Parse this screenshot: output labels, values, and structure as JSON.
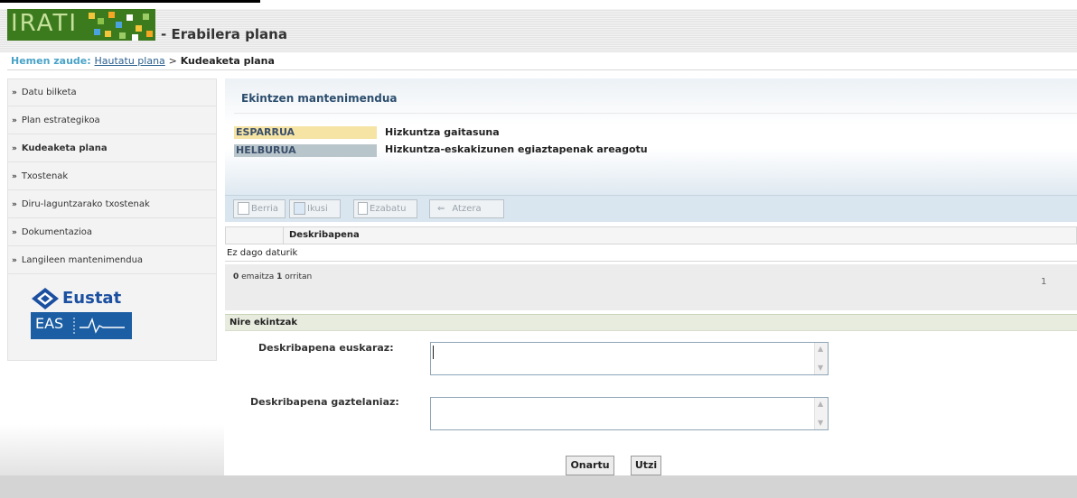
{
  "header": {
    "logo_text": "IRATI",
    "app_title": "- Erabilera plana"
  },
  "breadcrumb": {
    "label": "Hemen zaude:",
    "link": "Hautatu plana",
    "separator": ">",
    "current": "Kudeaketa plana"
  },
  "sidebar": {
    "chevron": "»",
    "items": [
      {
        "label": "Datu bilketa"
      },
      {
        "label": "Plan estrategikoa"
      },
      {
        "label": "Kudeaketa plana",
        "active": true
      },
      {
        "label": "Txostenak"
      },
      {
        "label": "Diru-laguntzarako txostenak"
      },
      {
        "label": "Dokumentazioa"
      },
      {
        "label": "Langileen mantenimendua"
      }
    ],
    "logos": {
      "eustat": "Eustat",
      "eas": "EAS"
    }
  },
  "main": {
    "title": "Ekintzen mantenimendua",
    "esparrua": {
      "label": "ESPARRUA",
      "value": "Hizkuntza gaitasuna"
    },
    "helburua": {
      "label": "HELBURUA",
      "value": "Hizkuntza-eskakizunen egiaztapenak areagotu"
    },
    "toolbar": {
      "berria": "Berria",
      "ikusi": "Ikusi",
      "ezabatu": "Ezabatu",
      "atzera": "Atzera"
    },
    "grid": {
      "column": "Deskribapena",
      "empty_text": "Ez dago daturik"
    },
    "pager": {
      "count": "0",
      "mid": "emaitza",
      "pages": "1",
      "suffix": "orritan",
      "current_page": "1"
    },
    "form": {
      "section_title": "Nire ekintzak",
      "label_eu": "Deskribapena euskaraz:",
      "label_es": "Deskribapena gaztelaniaz:",
      "value_eu": "",
      "value_es": ""
    },
    "buttons": {
      "onartu": "Onartu",
      "utzi": "Utzi"
    }
  },
  "colors": {
    "logo_bg": "#3c7a1e",
    "esparrua": "#f5e4a4",
    "helburua": "#b8c5cb",
    "toolbar": "#d9e5ef",
    "section_bar": "#e8ecdf"
  }
}
